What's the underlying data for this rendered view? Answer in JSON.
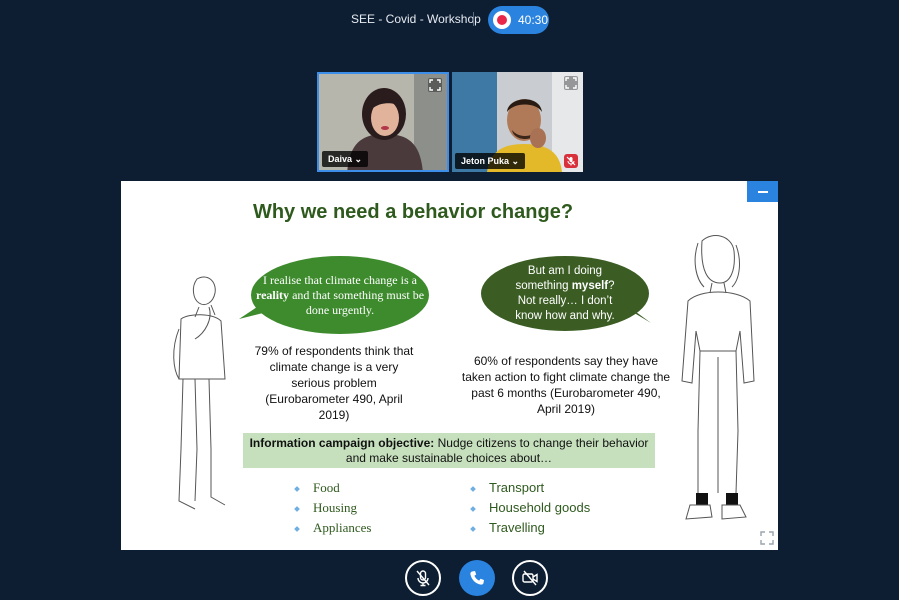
{
  "meeting": {
    "title": "SEE - Covid - Workshop",
    "timer": "40:30"
  },
  "participants": [
    {
      "name": "Daiva",
      "muted": false
    },
    {
      "name": "Jeton Puka",
      "muted": true
    }
  ],
  "slide": {
    "title": "Why we need a behavior change?",
    "bubble_left": {
      "pre": "I realise that climate change is a ",
      "bold": "reality",
      "post": " and that something must be done urgently."
    },
    "bubble_right": {
      "pre": "But am I doing something ",
      "bold": "myself",
      "post": "? Not really… I don’t know how and why."
    },
    "stat_left": "79% of respondents think that climate change is a very serious problem (Eurobarometer 490, April 2019)",
    "stat_right": "60% of respondents say they have taken action to fight climate change the past 6 months (Eurobarometer 490, April 2019)",
    "objective_label": "Information campaign objective:",
    "objective_text": " Nudge citizens to change their behavior and make sustainable choices about…",
    "list_left": [
      "Food",
      "Housing",
      "Appliances"
    ],
    "list_right": [
      "Transport",
      "Household goods",
      "Travelling"
    ]
  },
  "colors": {
    "accent": "#2b83e0",
    "background": "#0e1e32",
    "title_green": "#2f5a1e",
    "bubble_left": "#3d8b2d",
    "bubble_right": "#3b5d24",
    "objective_bg": "#c6e0bd",
    "record_red": "#e8284a"
  },
  "icons": {
    "record": "record-icon",
    "expand": "expand-icon",
    "mic_off": "mic-off-icon",
    "phone": "phone-icon",
    "camera_off": "camera-off-icon",
    "fullscreen": "fullscreen-icon",
    "minimize": "minimize-icon"
  }
}
